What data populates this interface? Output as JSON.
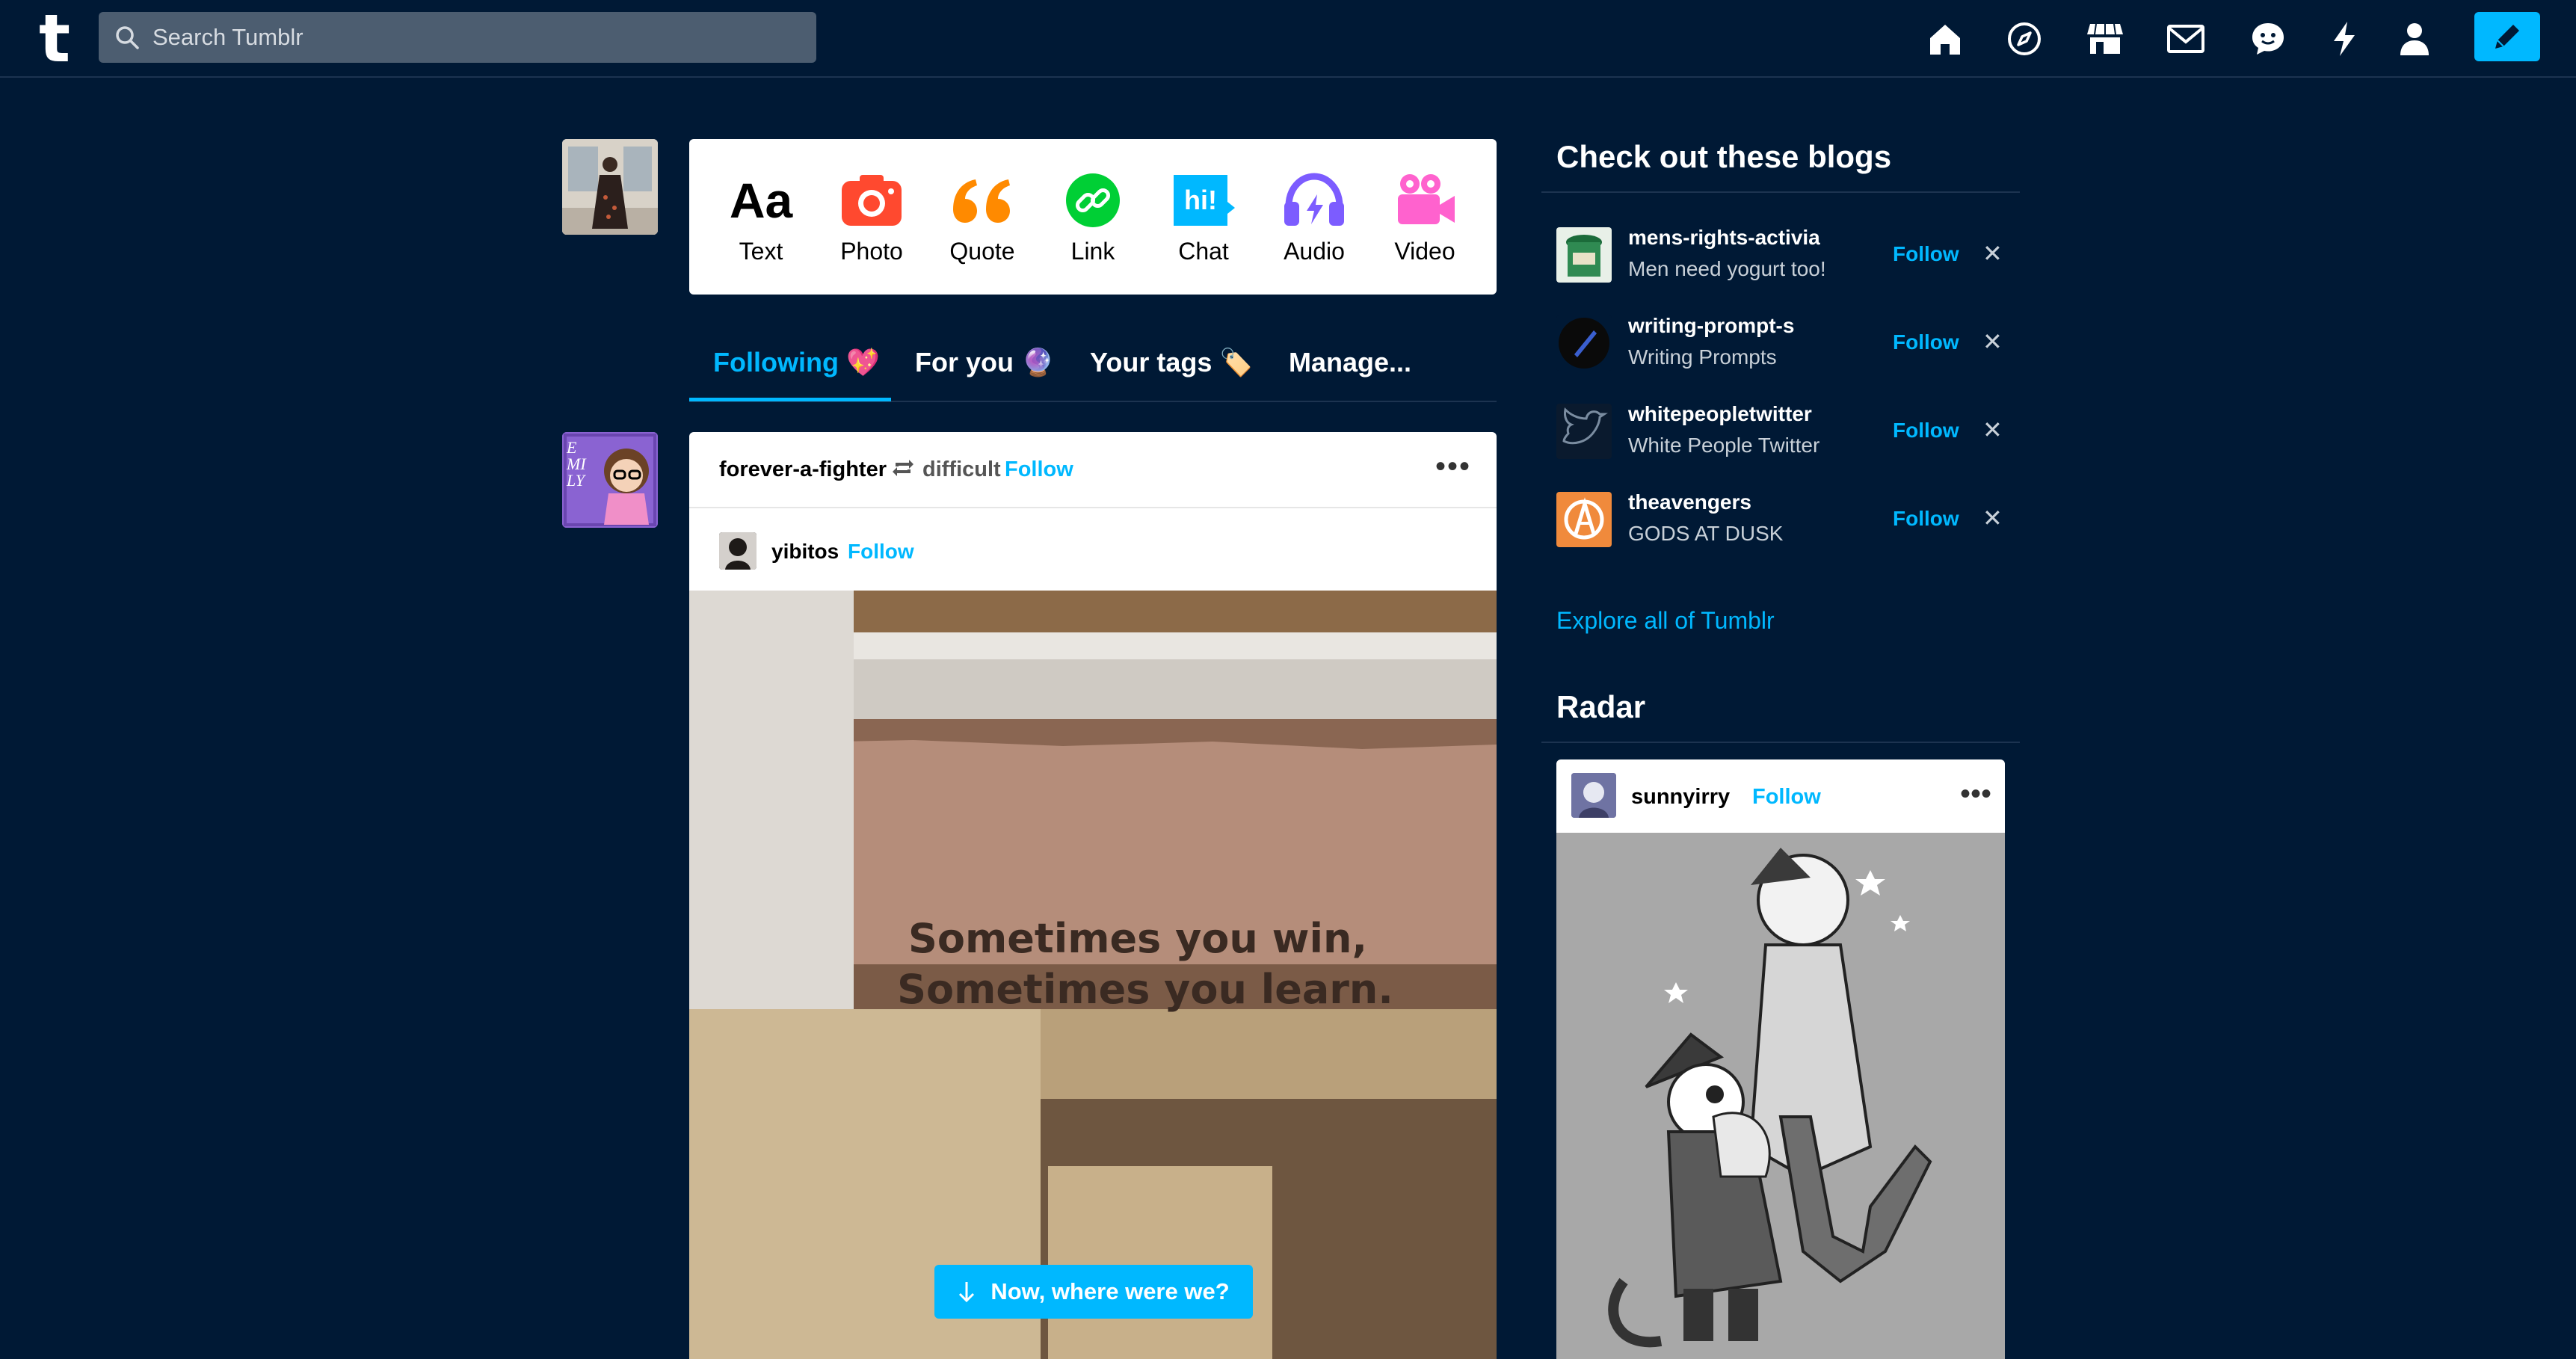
{
  "search": {
    "placeholder": "Search Tumblr"
  },
  "logo": "t",
  "nav_icons": [
    "home-icon",
    "explore-icon",
    "shop-icon",
    "inbox-icon",
    "messages-icon",
    "activity-icon",
    "account-icon",
    "compose-icon"
  ],
  "post_types": [
    {
      "label": "Text",
      "glyph": "Aa",
      "color": "#000000"
    },
    {
      "label": "Photo",
      "color": "#ff492f"
    },
    {
      "label": "Quote",
      "glyph": "66",
      "color": "#ff8a00"
    },
    {
      "label": "Link",
      "color": "#00cf35"
    },
    {
      "label": "Chat",
      "glyph": "hi!",
      "color": "#00b8ff"
    },
    {
      "label": "Audio",
      "color": "#7c5cff"
    },
    {
      "label": "Video",
      "color": "#ff62ce"
    }
  ],
  "tabs": [
    {
      "label": "Following 💖",
      "active": true
    },
    {
      "label": "For you 🔮",
      "active": false
    },
    {
      "label": "Your tags 🏷️",
      "active": false
    },
    {
      "label": "Manage...",
      "active": false
    }
  ],
  "post": {
    "blog": "forever-a-fighter",
    "reblogged_from": "difficult",
    "follow_label": "Follow",
    "more": "•••",
    "original_author": "yibitos",
    "original_follow": "Follow",
    "image_text_line1": "Sometimes you win,",
    "image_text_line2": "Sometimes you learn."
  },
  "resume_button": "Now, where were we?",
  "avatar_text": "EMILY",
  "sidebar": {
    "recommend_title": "Check out these blogs",
    "blogs": [
      {
        "name": "mens-rights-activia",
        "desc": "Men need yogurt too!",
        "follow": "Follow",
        "dismiss": "✕"
      },
      {
        "name": "writing-prompt-s",
        "desc": "Writing Prompts",
        "follow": "Follow",
        "dismiss": "✕"
      },
      {
        "name": "whitepeopletwitter",
        "desc": "White People Twitter",
        "follow": "Follow",
        "dismiss": "✕"
      },
      {
        "name": "theavengers",
        "desc": "GODS AT DUSK",
        "follow": "Follow",
        "dismiss": "✕"
      }
    ],
    "explore_link": "Explore all of Tumblr",
    "radar_title": "Radar",
    "radar_post": {
      "blog": "sunnyirry",
      "follow": "Follow",
      "more": "•••"
    }
  },
  "colors": {
    "background": "#001935",
    "accent": "#00b8ff",
    "card": "#ffffff"
  }
}
